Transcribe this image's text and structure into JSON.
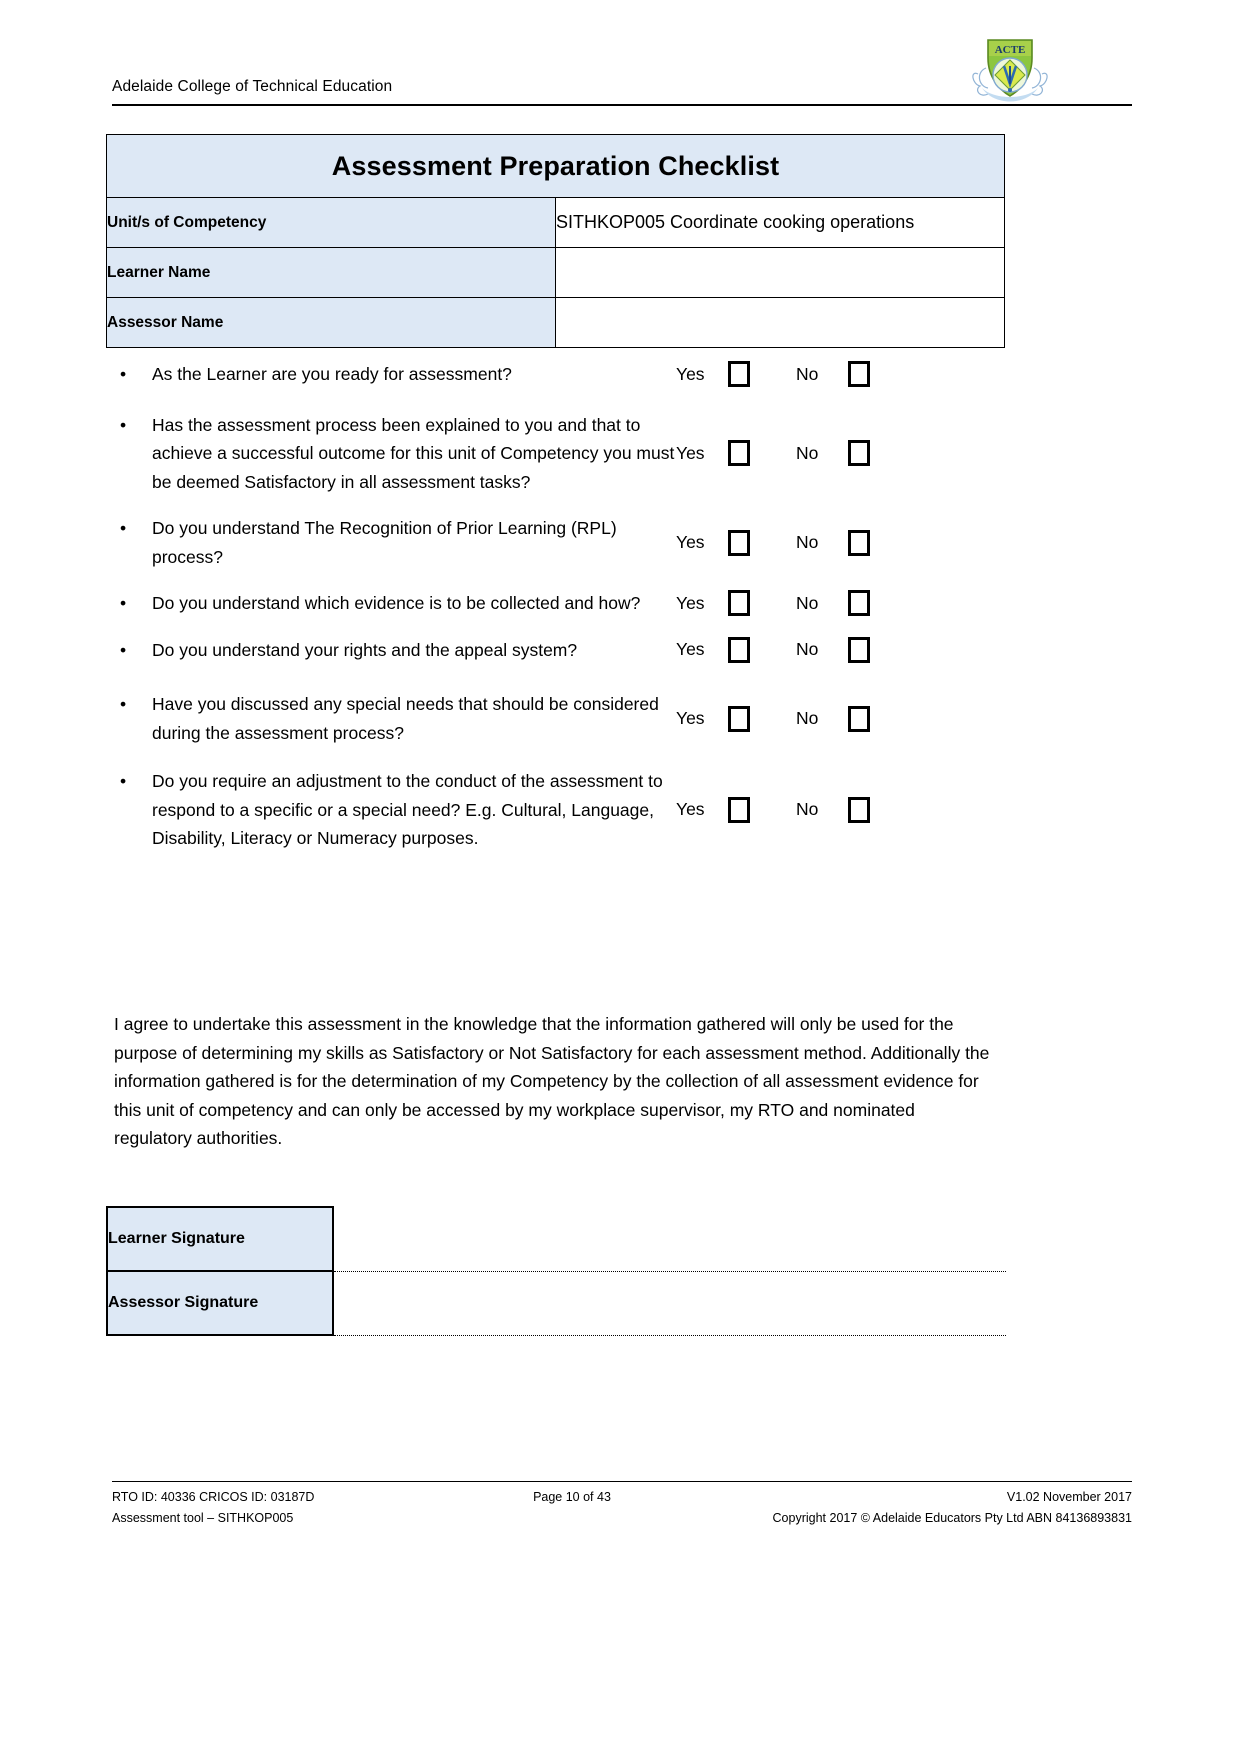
{
  "header": {
    "organisation": "Adelaide College of Technical Education",
    "logo_icon": "college-crest-logo"
  },
  "top_table": {
    "title": "Assessment Preparation Checklist",
    "rows": [
      {
        "label": "Unit/s of Competency",
        "value": "SITHKOP005  Coordinate cooking operations"
      },
      {
        "label": "Learner Name",
        "value": ""
      },
      {
        "label": "Assessor Name",
        "value": ""
      }
    ]
  },
  "checklist": {
    "yes_label": "Yes",
    "no_label": "No",
    "bullet": "•",
    "items": [
      {
        "question": "As the Learner are you ready for assessment?"
      },
      {
        "question": "Has the assessment process been explained to you and that to achieve a successful outcome for this unit of Competency you must be deemed Satisfactory in all assessment tasks?"
      },
      {
        "question": "Do you understand The Recognition of Prior Learning (RPL) process?"
      },
      {
        "question": "Do you understand which evidence is to be collected and how?"
      },
      {
        "question": "Do you understand your rights and the appeal system?"
      },
      {
        "question": "Have you discussed any special needs that should be considered during the assessment process?"
      },
      {
        "question": "Do you require an adjustment to the conduct of the assessment to respond to a specific or a special need? E.g. Cultural, Language, Disability, Literacy or Numeracy purposes."
      }
    ]
  },
  "agreement": {
    "text": "I agree to undertake this assessment in the knowledge that the information gathered will only be used for the purpose of determining my skills as Satisfactory or Not Satisfactory for each assessment method. Additionally the information gathered is for the determination of my Competency by the collection of all assessment evidence for this unit of competency and can only be accessed by my workplace supervisor, my RTO and nominated regulatory authorities."
  },
  "signature_table": {
    "rows": [
      {
        "label": "Learner Signature",
        "value": ""
      },
      {
        "label": "Assessor Signature",
        "value": ""
      }
    ]
  },
  "footer": {
    "left_line1": "RTO ID: 40336 CRICOS ID: 03187D",
    "left_line2": "Assessment tool – SITHKOP005",
    "center_line1": "Page 10 of 43",
    "right_line1": "V1.02 November 2017",
    "right_line2": "Copyright 2017 © Adelaide Educators Pty Ltd ABN 84136893831"
  },
  "colors": {
    "header_fill": "#dde8f5",
    "border": "#000000",
    "text": "#000000"
  }
}
